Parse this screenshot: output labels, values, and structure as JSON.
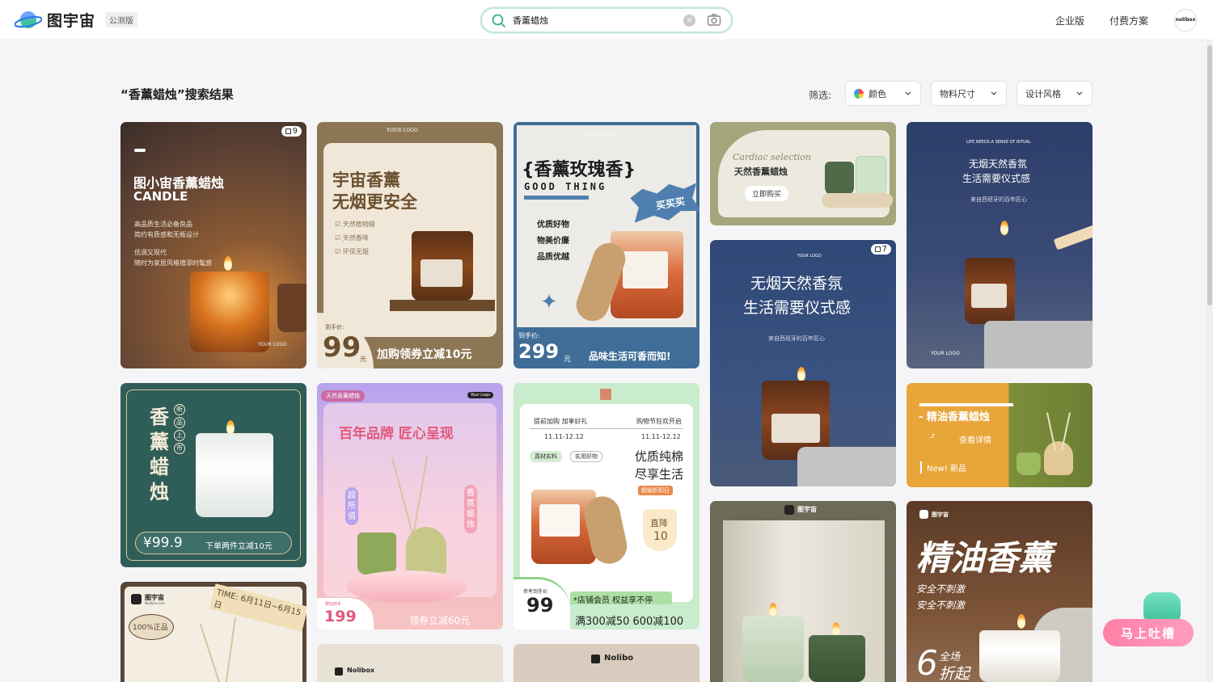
{
  "header": {
    "logo_text": "图宇宙",
    "beta_label": "公测版",
    "search_value": "香薰蜡烛",
    "nav": {
      "enterprise": "企业版",
      "pricing": "付费方案"
    },
    "avatar_text": "nolibox"
  },
  "results": {
    "title": "“香薰蜡烛”搜索结果",
    "filter_label": "筛选:",
    "filters": {
      "color": "颜色",
      "size": "物料尺寸",
      "style": "设计风格"
    }
  },
  "cards": {
    "c1": {
      "badge": "9",
      "title": "图小宙香薰蜡烛",
      "subtitle": "CANDLE",
      "line1": "高品质生活必备良品",
      "line2": "简约有质感和无瓶设计",
      "line3": "低调又现代",
      "line4": "随时为家居风格增添时髦感",
      "logo": "YOUR LOGO"
    },
    "c2": {
      "logo": "YOUR LOGO",
      "title1": "宇宙香薰",
      "title2": "无烟更安全",
      "item1": "天然植物蜡",
      "item2": "天然香味",
      "item3": "环保无烟",
      "price_label": "到手价:",
      "price": "99",
      "unit": "元",
      "promo": "加购领券立减10元"
    },
    "c3": {
      "logo": "YOUR LOGO",
      "title": "{香薰玫瑰香}",
      "subtitle": "GOOD THING",
      "burst": "买买买",
      "f1": "优质好物",
      "f2": "物美价廉",
      "f3": "品质优越",
      "price_label": "到手价:",
      "price": "299",
      "unit": "元",
      "slogan": "品味生活可香而知!"
    },
    "c4": {
      "script": "Cardiac selection",
      "title": "天然香薰蜡烛",
      "button": "立即购买"
    },
    "c5": {
      "top": "LIFE NEEDS A SENSE OF RITUAL",
      "title1": "无烟天然香氛",
      "title2": "生活需要仪式感",
      "sub": "来自西班牙的百年匠心",
      "logo": "YOUR LOGO"
    },
    "c6": {
      "logo": "YOUR LOGO",
      "badge": "7",
      "title1": "无烟天然香氛",
      "title2": "生活需要仪式感",
      "sub": "来自西班牙的百年匠心"
    },
    "c7": {
      "v1": "香",
      "v2": "薰",
      "v3": "蜡",
      "v4": "烛",
      "tag1": "新",
      "tag2": "品",
      "tag3": "上",
      "tag4": "市",
      "price": "¥99.9",
      "promo": "下单两件立减10元"
    },
    "c8": {
      "tag": "天然香薰蜡烛",
      "logo": "Your Logo",
      "title": "百年品牌  匠心呈现",
      "left": "超所值",
      "right": "香氛蜡烛",
      "price_label": "预估到手",
      "price": "199",
      "promo": "领券立减60元"
    },
    "c9": {
      "pre1": "提前加购 加享好礼",
      "pre2": "购物节狂欢开启",
      "d1": "11.11-12.12",
      "d2": "11.11-12.12",
      "chip1": "真材实料",
      "chip2": "实用好物",
      "t1": "优质纯棉",
      "t2": "尽享生活",
      "tag": "超级折扣日",
      "drop": "直降",
      "drop_val": "10",
      "ref": "参考到手价",
      "price": "99",
      "member": "*店铺会员 权益享不停",
      "deal": "满300减50 600减100"
    },
    "c10": {
      "title": "- 精油香薰蜡烛",
      "link": "查看详情",
      "new": "New! 新品"
    },
    "c11": {
      "logo": "图宇宙",
      "logo_sub": "Nolibox.com",
      "time": "TIME: 6月11日~6月15日",
      "stamp": "100%正品"
    },
    "c12": {
      "logo": "Nolibox"
    },
    "c13": {
      "logo": "Nolibo"
    },
    "c14": {
      "logo": "图宇宙"
    },
    "c15": {
      "logo": "图宇宙",
      "title": "精油香薰",
      "l1": "安全不刺激",
      "l2": "安全不刺激",
      "big": "6",
      "sm1": "全场",
      "sm2": "折起"
    }
  },
  "feedback": {
    "label": "马上吐槽"
  }
}
